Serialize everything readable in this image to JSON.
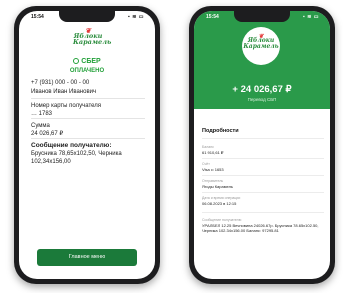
{
  "left_phone": {
    "status_time": "15:54",
    "status_icons": "▪ ≋ ▭",
    "logo_text": "Яблоки Карамель",
    "logo_line1": "Яблоки",
    "logo_line2": "Карамель",
    "bank": "СБЕР",
    "status": "ОПЛАЧЕНО",
    "phone": "+7 (931) 000 - 00 - 00",
    "recipient": "Иванов Иван Иванович",
    "card_label": "Номер карты получателя",
    "card_value": "… 1783",
    "sum_label": "Сумма",
    "sum_value": "24 026,67 ₽",
    "message_label": "Сообщение получателю:",
    "message_value": "Брусника 78,65х102,50, Черника 102,34х156,00",
    "button": "Главное меню"
  },
  "right_phone": {
    "status_time": "15:54",
    "status_icons": "▪ ≋ ▭",
    "logo_line1": "Яблоки",
    "logo_line2": "Карамель",
    "amount": "+ 24 026,67 ₽",
    "amount_sub": "Перевод СБП",
    "details_title": "Подробности",
    "fields": [
      {
        "label": "Баланс",
        "value": "61 910,61 ₽"
      },
      {
        "label": "Счёт",
        "value": "Visa •• 1653"
      },
      {
        "label": "Отправитель",
        "value": "Ягоды Карамель"
      },
      {
        "label": "Дата и время операции",
        "value": "06.08.2023 в 12:15"
      },
      {
        "label": "Сообщение получателю",
        "value": "УРАЛБЕЛ 12.25 Вечновина 24026.67р. Брусника 78.65х102.50, Черника 102.34х156.00 Баланс: 97295.81"
      }
    ]
  },
  "colors": {
    "accent_green": "#21a038",
    "header_green": "#2a9a4a",
    "button_green": "#1b7a3a"
  }
}
